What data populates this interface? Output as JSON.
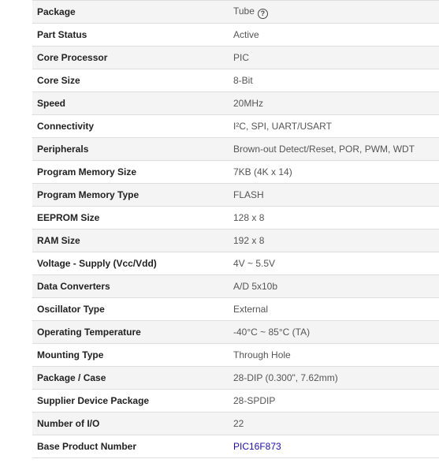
{
  "specs": [
    {
      "name": "package",
      "label": "Package",
      "value": "Tube",
      "icon": "help-circle-icon"
    },
    {
      "name": "part-status",
      "label": "Part Status",
      "value": "Active"
    },
    {
      "name": "core-processor",
      "label": "Core Processor",
      "value": "PIC"
    },
    {
      "name": "core-size",
      "label": "Core Size",
      "value": "8-Bit"
    },
    {
      "name": "speed",
      "label": "Speed",
      "value": "20MHz"
    },
    {
      "name": "connectivity",
      "label": "Connectivity",
      "value": "I²C, SPI, UART/USART"
    },
    {
      "name": "peripherals",
      "label": "Peripherals",
      "value": "Brown-out Detect/Reset, POR, PWM, WDT"
    },
    {
      "name": "program-memory-size",
      "label": "Program Memory Size",
      "value": "7KB (4K x 14)"
    },
    {
      "name": "program-memory-type",
      "label": "Program Memory Type",
      "value": "FLASH"
    },
    {
      "name": "eeprom-size",
      "label": "EEPROM Size",
      "value": "128 x 8"
    },
    {
      "name": "ram-size",
      "label": "RAM Size",
      "value": "192 x 8"
    },
    {
      "name": "voltage-supply",
      "label": "Voltage - Supply (Vcc/Vdd)",
      "value": "4V ~ 5.5V"
    },
    {
      "name": "data-converters",
      "label": "Data Converters",
      "value": "A/D 5x10b"
    },
    {
      "name": "oscillator-type",
      "label": "Oscillator Type",
      "value": "External"
    },
    {
      "name": "operating-temperature",
      "label": "Operating Temperature",
      "value": "-40°C ~ 85°C (TA)"
    },
    {
      "name": "mounting-type",
      "label": "Mounting Type",
      "value": "Through Hole"
    },
    {
      "name": "package-case",
      "label": "Package / Case",
      "value": "28-DIP (0.300\", 7.62mm)"
    },
    {
      "name": "supplier-device-package",
      "label": "Supplier Device Package",
      "value": "28-SPDIP"
    },
    {
      "name": "number-of-io",
      "label": "Number of I/O",
      "value": "22"
    },
    {
      "name": "base-product-number",
      "label": "Base Product Number",
      "value": "PIC16F873",
      "link": true
    }
  ],
  "colors": {
    "link": "#1a0dab",
    "stripe": "#f4f4f4",
    "border": "#dedede"
  }
}
